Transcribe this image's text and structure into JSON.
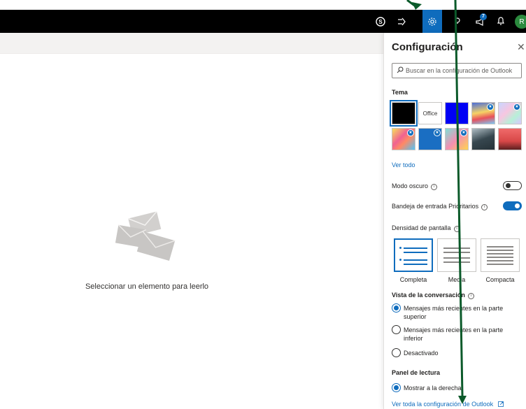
{
  "header": {
    "icons": [
      "skype-icon",
      "share-icon",
      "gear-icon",
      "help-icon",
      "megaphone-icon",
      "bell-icon"
    ],
    "badge_count": "7",
    "avatar_initial": "R",
    "accent": "#0f6cbd"
  },
  "main": {
    "empty_message": "Seleccionar un elemento para leerlo"
  },
  "settings": {
    "title": "Configuración",
    "search_placeholder": "Buscar en la configuración de Outlook",
    "theme_heading": "Tema",
    "theme_office_label": "Office",
    "see_all": "Ver todo",
    "dark_mode_label": "Modo oscuro",
    "dark_mode_on": false,
    "focused_inbox_label": "Bandeja de entrada Prioritarios",
    "focused_inbox_on": true,
    "density_heading": "Densidad de pantalla",
    "density_options": [
      "Completa",
      "Media",
      "Compacta"
    ],
    "density_selected": "Completa",
    "conversation_heading": "Vista de la conversación",
    "conversation_options": [
      "Mensajes más recientes en la parte superior",
      "Mensajes más recientes en la parte inferior",
      "Desactivado"
    ],
    "conversation_selected": 0,
    "reading_pane_heading": "Panel de lectura",
    "reading_pane_option": "Mostrar a la derecha",
    "view_all_settings": "Ver toda la configuración de Outlook"
  },
  "annotation": {
    "arrow_color": "#0b5a2a"
  }
}
